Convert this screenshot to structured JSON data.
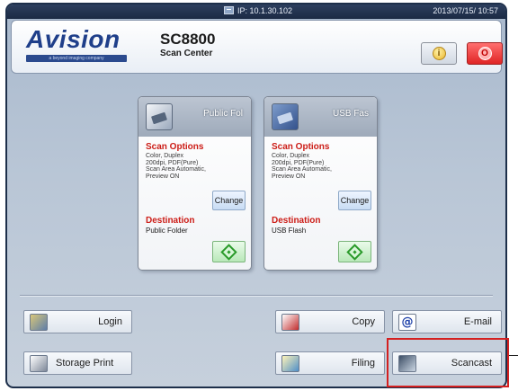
{
  "statusbar": {
    "ip": "IP: 10.1.30.102",
    "datetime": "2013/07/15/ 10:57"
  },
  "header": {
    "logo": "Avision",
    "logo_tagline": "a beyond imaging company",
    "model": "SC8800",
    "subtitle": "Scan Center",
    "info_symbol": "i",
    "power_symbol": "O"
  },
  "cards": [
    {
      "title": "Public Fol",
      "icon": "scanner-icon",
      "scan_options_label": "Scan Options",
      "options": [
        "Color, Duplex",
        "200dpi, PDF(Pure)",
        "Scan Area Automatic,",
        "Preview ON"
      ],
      "change_label": "Change",
      "destination_label": "Destination",
      "destination": "Public Folder"
    },
    {
      "title": "USB Fas",
      "icon": "usb-icon",
      "scan_options_label": "Scan Options",
      "options": [
        "Color, Duplex",
        "200dpi, PDF(Pure)",
        "Scan Area Automatic,",
        "Preview ON"
      ],
      "change_label": "Change",
      "destination_label": "Destination",
      "destination": "USB Flash"
    }
  ],
  "functions": {
    "login": "Login",
    "copy": "Copy",
    "email": "E-mail",
    "storage_print": "Storage Print",
    "filing": "Filing",
    "scancast": "Scancast",
    "email_symbol": "@"
  },
  "colors": {
    "accent_red": "#cc1c16",
    "start_green": "#2a9a2a",
    "highlight": "#d42020",
    "brand_blue": "#1f3f8a"
  }
}
